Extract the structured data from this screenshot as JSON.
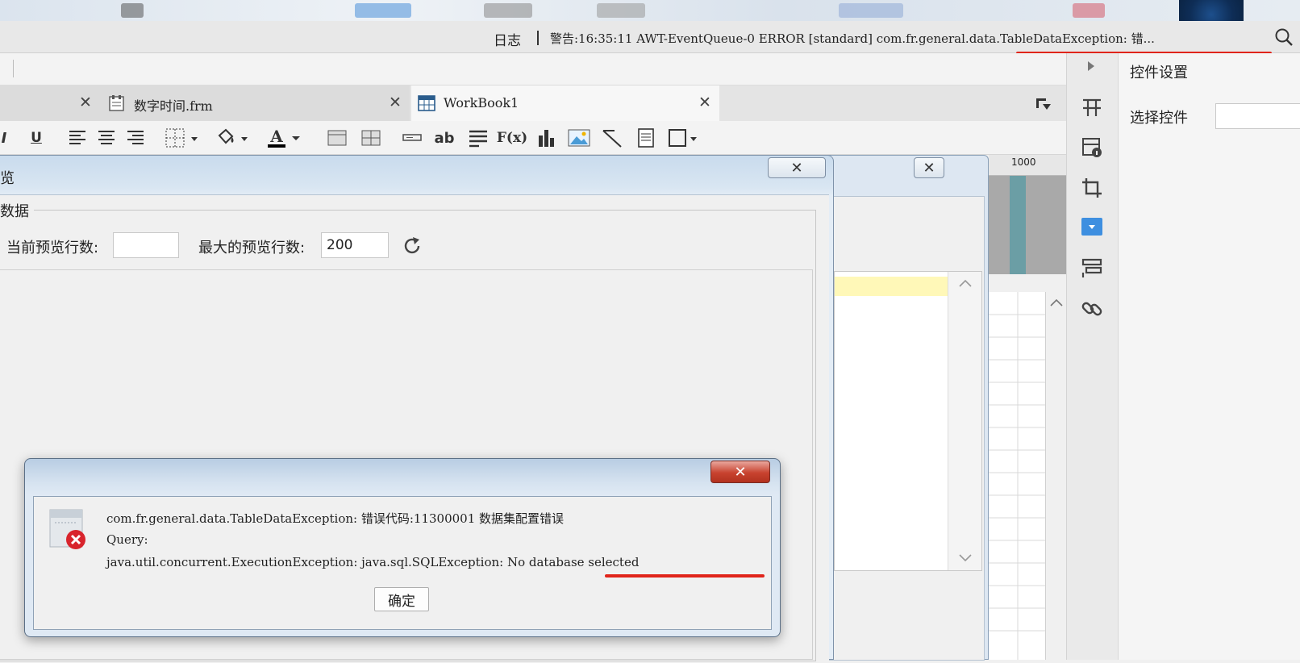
{
  "log_bar": {
    "label": "日志",
    "message": "警告:16:35:11 AWT-EventQueue-0 ERROR [standard] com.fr.general.data.TableDataException: 错..."
  },
  "tabs": [
    {
      "label": "",
      "active": false
    },
    {
      "label": "数字时间.frm",
      "active": false
    },
    {
      "label": "WorkBook1",
      "active": true
    }
  ],
  "toolbar": {
    "italic_label": "I",
    "underline_label": "U",
    "font_color_label": "A",
    "text_ab_label": "ab",
    "formula_label": "F(x)",
    "font_color": "#000000"
  },
  "ruler": {
    "mark": "1000"
  },
  "control_panel": {
    "title": "控件设置",
    "select_label": "选择控件"
  },
  "preview_dialog": {
    "title": "览",
    "section_label": "数据",
    "current_rows_label": "当前预览行数:",
    "current_rows_value": "",
    "max_rows_label": "最大的预览行数:",
    "max_rows_value": "200"
  },
  "error_dialog": {
    "line1": "com.fr.general.data.TableDataException: 错误代码:11300001 数据集配置错误",
    "line2": "Query:",
    "line3": "java.util.concurrent.ExecutionException: java.sql.SQLException: No database selected",
    "ok_label": "确定"
  },
  "colors": {
    "highlight_underline": "#e0251b",
    "selected_row": "#fff8b8",
    "active_control_icon": "#3e8fe0",
    "error_badge": "#d8242c"
  }
}
